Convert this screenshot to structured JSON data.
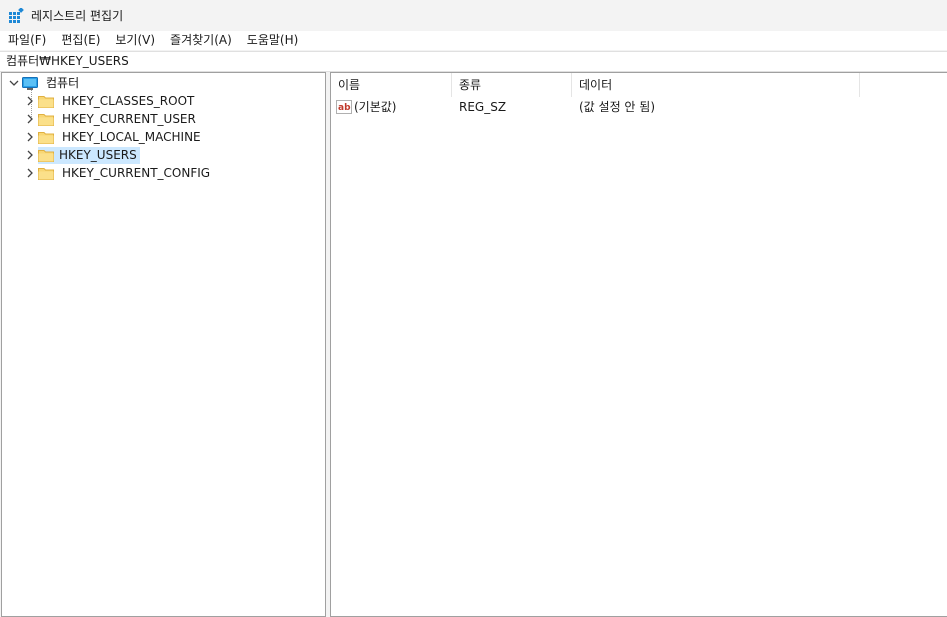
{
  "window": {
    "title": "레지스트리 편집기"
  },
  "menu": {
    "items": [
      {
        "label": "파일(F)"
      },
      {
        "label": "편집(E)"
      },
      {
        "label": "보기(V)"
      },
      {
        "label": "즐겨찾기(A)"
      },
      {
        "label": "도움말(H)"
      }
    ]
  },
  "address": {
    "path": "컴퓨터₩HKEY_USERS"
  },
  "tree": {
    "root": {
      "label": "컴퓨터",
      "icon": "computer-icon",
      "expanded": true
    },
    "children": [
      {
        "label": "HKEY_CLASSES_ROOT",
        "icon": "folder-icon",
        "selected": false
      },
      {
        "label": "HKEY_CURRENT_USER",
        "icon": "folder-icon",
        "selected": false
      },
      {
        "label": "HKEY_LOCAL_MACHINE",
        "icon": "folder-icon",
        "selected": false
      },
      {
        "label": "HKEY_USERS",
        "icon": "folder-icon",
        "selected": true
      },
      {
        "label": "HKEY_CURRENT_CONFIG",
        "icon": "folder-icon",
        "selected": false
      }
    ]
  },
  "list": {
    "columns": [
      {
        "label": "이름"
      },
      {
        "label": "종류"
      },
      {
        "label": "데이터"
      }
    ],
    "rows": [
      {
        "name": "(기본값)",
        "type": "REG_SZ",
        "data": "(값 설정 안 됨)",
        "icon": "string-value-icon"
      }
    ]
  },
  "colors": {
    "selection": "#cce8ff",
    "folder": "#f8d775",
    "folder_dark": "#e8b84a",
    "computer": "#1e88d6"
  }
}
